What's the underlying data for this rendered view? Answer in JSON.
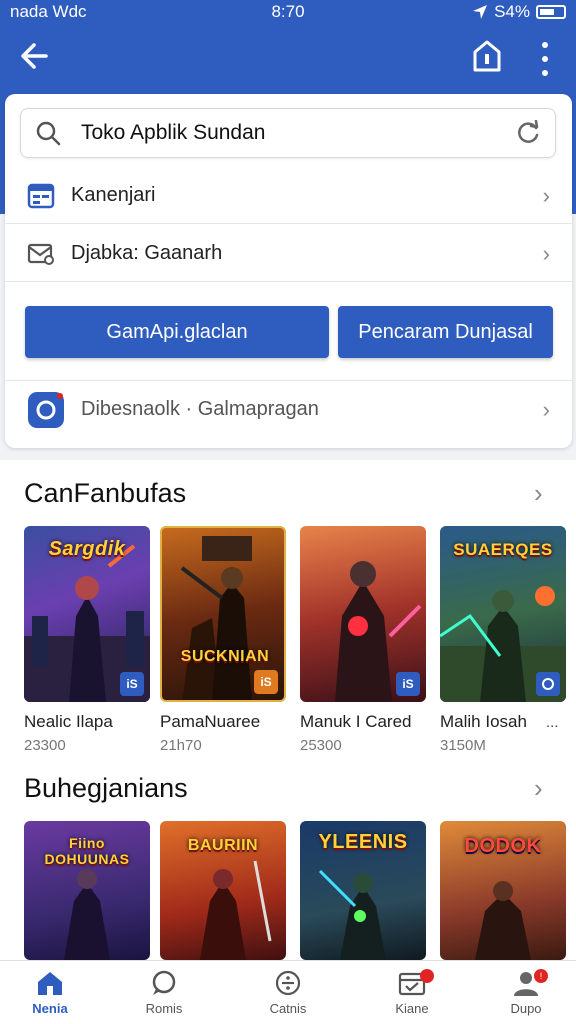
{
  "status_bar": {
    "left": "nada Wdc",
    "time": "8:70",
    "battery": "S4%"
  },
  "search": {
    "value": "Toko Apblik Sundan"
  },
  "menu": {
    "row1": "Kanenjari",
    "row2": "Djabka: Gaanarh",
    "button_left": "GamApi.glaclan",
    "button_right": "Pencaram Dunjasal",
    "row3": "Dibesnaolk · Galmapragan"
  },
  "section1": {
    "title": "CanFanbufas",
    "games": [
      {
        "name": "Nealic Ilapa",
        "size": "23300",
        "art_title": "Sargdik",
        "badge": "iS"
      },
      {
        "name": "PamaNuaree",
        "size": "21h70",
        "art_title": "SUCKNIAN",
        "badge": "iS"
      },
      {
        "name": "Manuk I Cared",
        "size": "25300",
        "art_title": "",
        "badge": "iS"
      },
      {
        "name": "Malih Iosah",
        "size": "3150M",
        "art_title": "SUAERQES",
        "badge": ""
      }
    ],
    "more_dots": "..."
  },
  "section2": {
    "title": "Buhegjanians",
    "games": [
      {
        "art_title": "Fiino DOHUUNAS"
      },
      {
        "art_title": "BAURIIN"
      },
      {
        "art_title": "YLEENIS"
      },
      {
        "art_title": "DODOK"
      }
    ]
  },
  "nav": {
    "items": [
      {
        "label": "Nenia"
      },
      {
        "label": "Romis"
      },
      {
        "label": "Catnis"
      },
      {
        "label": "Kiane"
      },
      {
        "label": "Dupo"
      }
    ],
    "badge_profile": "!"
  }
}
